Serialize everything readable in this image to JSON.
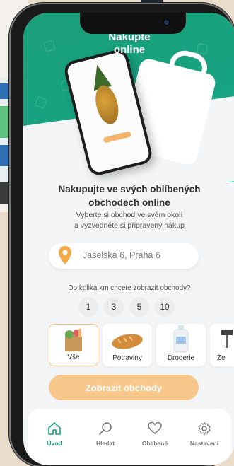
{
  "hero": {
    "title_line1": "Nakupte",
    "title_line2": "online"
  },
  "main": {
    "heading_line1": "Nakupujte ve svých oblíbených",
    "heading_line2": "obchodech online",
    "sub_line1": "Vyberte si obchod ve svém okolí",
    "sub_line2": "a vyzvedněte si připravený nákup"
  },
  "address": {
    "value": "Jaselská 6, Praha 6",
    "icon": "location-pin-icon"
  },
  "distance": {
    "question": "Do kolika km chcete zobrazit obchody?",
    "options": [
      "1",
      "3",
      "5",
      "10"
    ]
  },
  "categories": [
    {
      "label": "Vše",
      "selected": true
    },
    {
      "label": "Potraviny",
      "selected": false
    },
    {
      "label": "Drogerie",
      "selected": false
    },
    {
      "label": "Že",
      "selected": false
    }
  ],
  "cta": {
    "label": "Zobrazit obchody"
  },
  "tabbar": [
    {
      "label": "Úvod",
      "icon": "home-icon",
      "active": true
    },
    {
      "label": "Hledat",
      "icon": "search-icon",
      "active": false
    },
    {
      "label": "Oblíbené",
      "icon": "heart-icon",
      "active": false
    },
    {
      "label": "Nastavení",
      "icon": "gear-icon",
      "active": false
    }
  ],
  "colors": {
    "brand_green": "#1ba07a",
    "accent_orange": "#f8c78b",
    "pin_orange": "#f5a846"
  }
}
